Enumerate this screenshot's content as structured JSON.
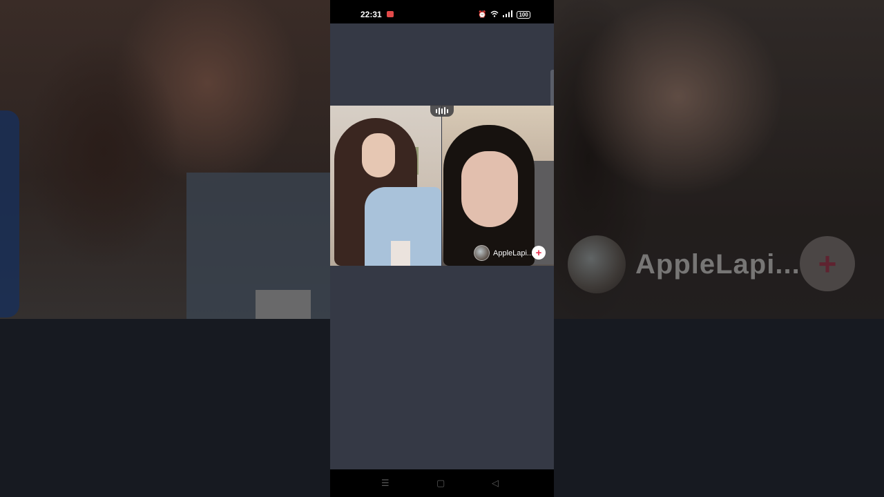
{
  "status_bar": {
    "time": "22:31",
    "icons": [
      "alarm-icon",
      "wifi-icon",
      "signal-icon"
    ],
    "battery": "100"
  },
  "video_call": {
    "voice_indicator_icon": "audio-waves-icon",
    "remote_user": {
      "name": "AppleLapi..."
    }
  },
  "navigation": {
    "menu_glyph": "☰",
    "home_glyph": "▢",
    "back_glyph": "◁"
  },
  "colors": {
    "background": "#353945",
    "follow_plus": "#e6304e"
  }
}
